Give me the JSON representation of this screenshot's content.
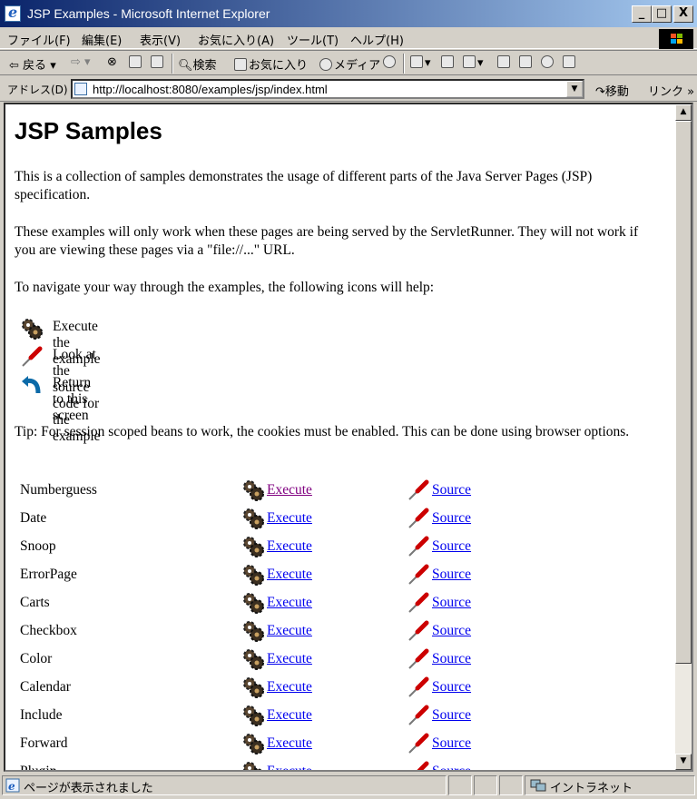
{
  "window": {
    "title": "JSP Examples - Microsoft Internet Explorer",
    "minimize": "_",
    "maximize": "□",
    "close": "X"
  },
  "menu": [
    "ファイル(F)",
    "編集(E)",
    "表示(V)",
    "お気に入り(A)",
    "ツール(T)",
    "ヘルプ(H)"
  ],
  "toolbar": {
    "back": "戻る",
    "search": "検索",
    "favorites": "お気に入り",
    "media": "メディア"
  },
  "address": {
    "label": "アドレス(D)",
    "url": "http://localhost:8080/examples/jsp/index.html",
    "go": "移動",
    "links": "リンク »"
  },
  "page": {
    "heading": "JSP Samples",
    "intro": "This is a collection of samples demonstrates the usage of different parts of the Java Server Pages (JSP) specification.",
    "note": "These examples will only work when these pages are being served by the ServletRunner. They will not work if you are viewing these pages via a \"file://...\" URL.",
    "navigate": "To navigate your way through the examples, the following icons will help:",
    "legend": [
      {
        "icon": "gears-icon",
        "text": "Execute the example"
      },
      {
        "icon": "screwdriver-icon",
        "text": "Look at the source code for the example"
      },
      {
        "icon": "return-arrow-icon",
        "text": "Return to this screen"
      }
    ],
    "tip": "Tip: For session scoped beans to work, the cookies must be enabled. This can be done using browser options.",
    "execute_label": "Execute",
    "source_label": "Source",
    "examples": [
      {
        "name": "Numberguess",
        "visited": true
      },
      {
        "name": "Date",
        "visited": false
      },
      {
        "name": "Snoop",
        "visited": false
      },
      {
        "name": "ErrorPage",
        "visited": false
      },
      {
        "name": "Carts",
        "visited": false
      },
      {
        "name": "Checkbox",
        "visited": false
      },
      {
        "name": "Color",
        "visited": false
      },
      {
        "name": "Calendar",
        "visited": false
      },
      {
        "name": "Include",
        "visited": false
      },
      {
        "name": "Forward",
        "visited": false
      },
      {
        "name": "Plugin",
        "visited": false
      }
    ]
  },
  "status": {
    "text": "ページが表示されました",
    "zone": "イントラネット"
  },
  "colors": {
    "link": "#0000ee",
    "visited": "#800080",
    "titlebar_start": "#0a246a",
    "titlebar_end": "#a6caf0"
  }
}
